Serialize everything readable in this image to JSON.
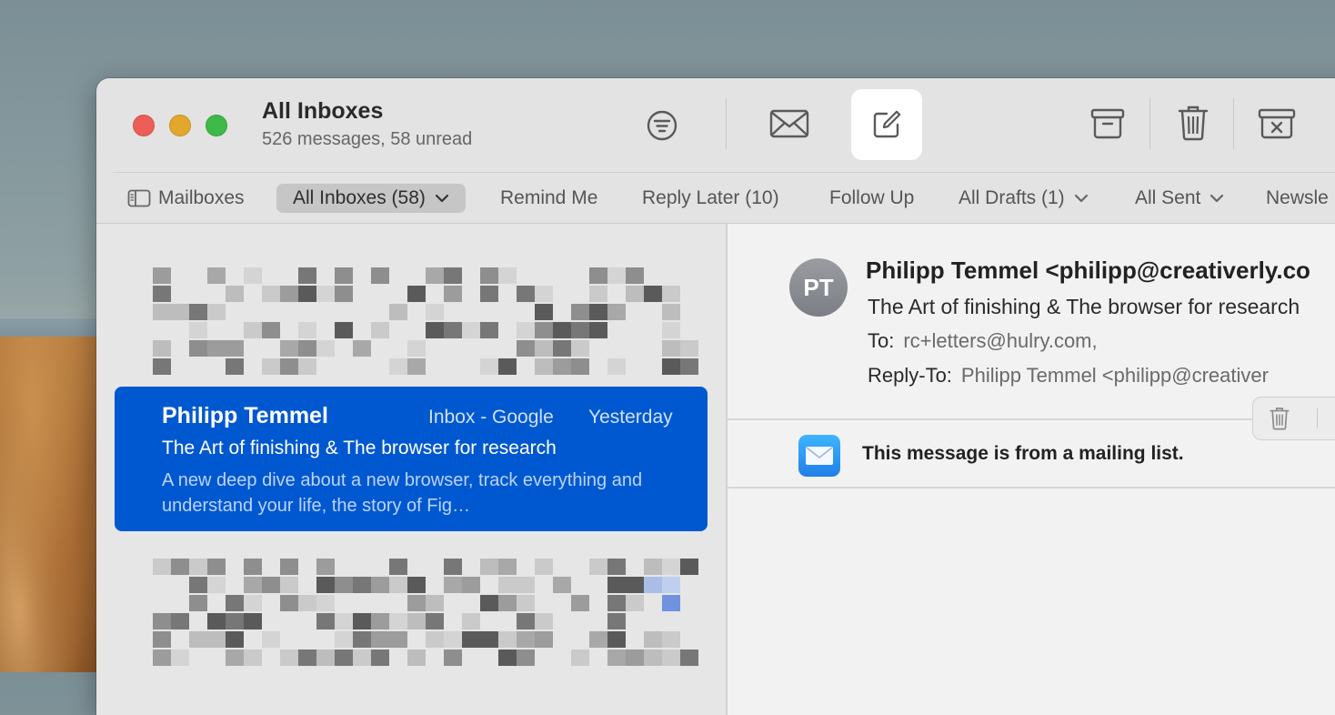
{
  "window": {
    "title": "All Inboxes",
    "subtitle": "526 messages, 58 unread"
  },
  "toolbar": {
    "icons": [
      "filter-icon",
      "get-mail-icon",
      "compose-icon",
      "archive-icon",
      "trash-icon",
      "junk-icon"
    ]
  },
  "favorites": {
    "mailboxes": "Mailboxes",
    "all_inboxes": "All Inboxes (58)",
    "remind_me": "Remind Me",
    "reply_later": "Reply Later (10)",
    "follow_up": "Follow Up",
    "all_drafts": "All Drafts (1)",
    "all_sent": "All Sent",
    "newsletters": "Newsle"
  },
  "selected_message": {
    "sender": "Philipp Temmel",
    "mailbox": "Inbox - Google",
    "date": "Yesterday",
    "subject": "The Art of finishing & The browser for research",
    "preview": "A new deep dive about a new browser, track everything and understand your life, the story of Fig…"
  },
  "reader": {
    "avatar_initials": "PT",
    "from": "Philipp Temmel <philipp@creativerly.co",
    "subject": "The Art of finishing & The browser for research",
    "to_label": "To:",
    "to_value": "rc+letters@hulry.com,",
    "reply_to_label": "Reply-To:",
    "reply_to_value": "Philipp Temmel <philipp@creativer",
    "mailing_list_notice": "This message is from a mailing list."
  },
  "colors": {
    "selection": "#0058d0",
    "traffic_red": "#ed5e57",
    "traffic_yellow": "#e1a82c",
    "traffic_green": "#3dba48"
  }
}
